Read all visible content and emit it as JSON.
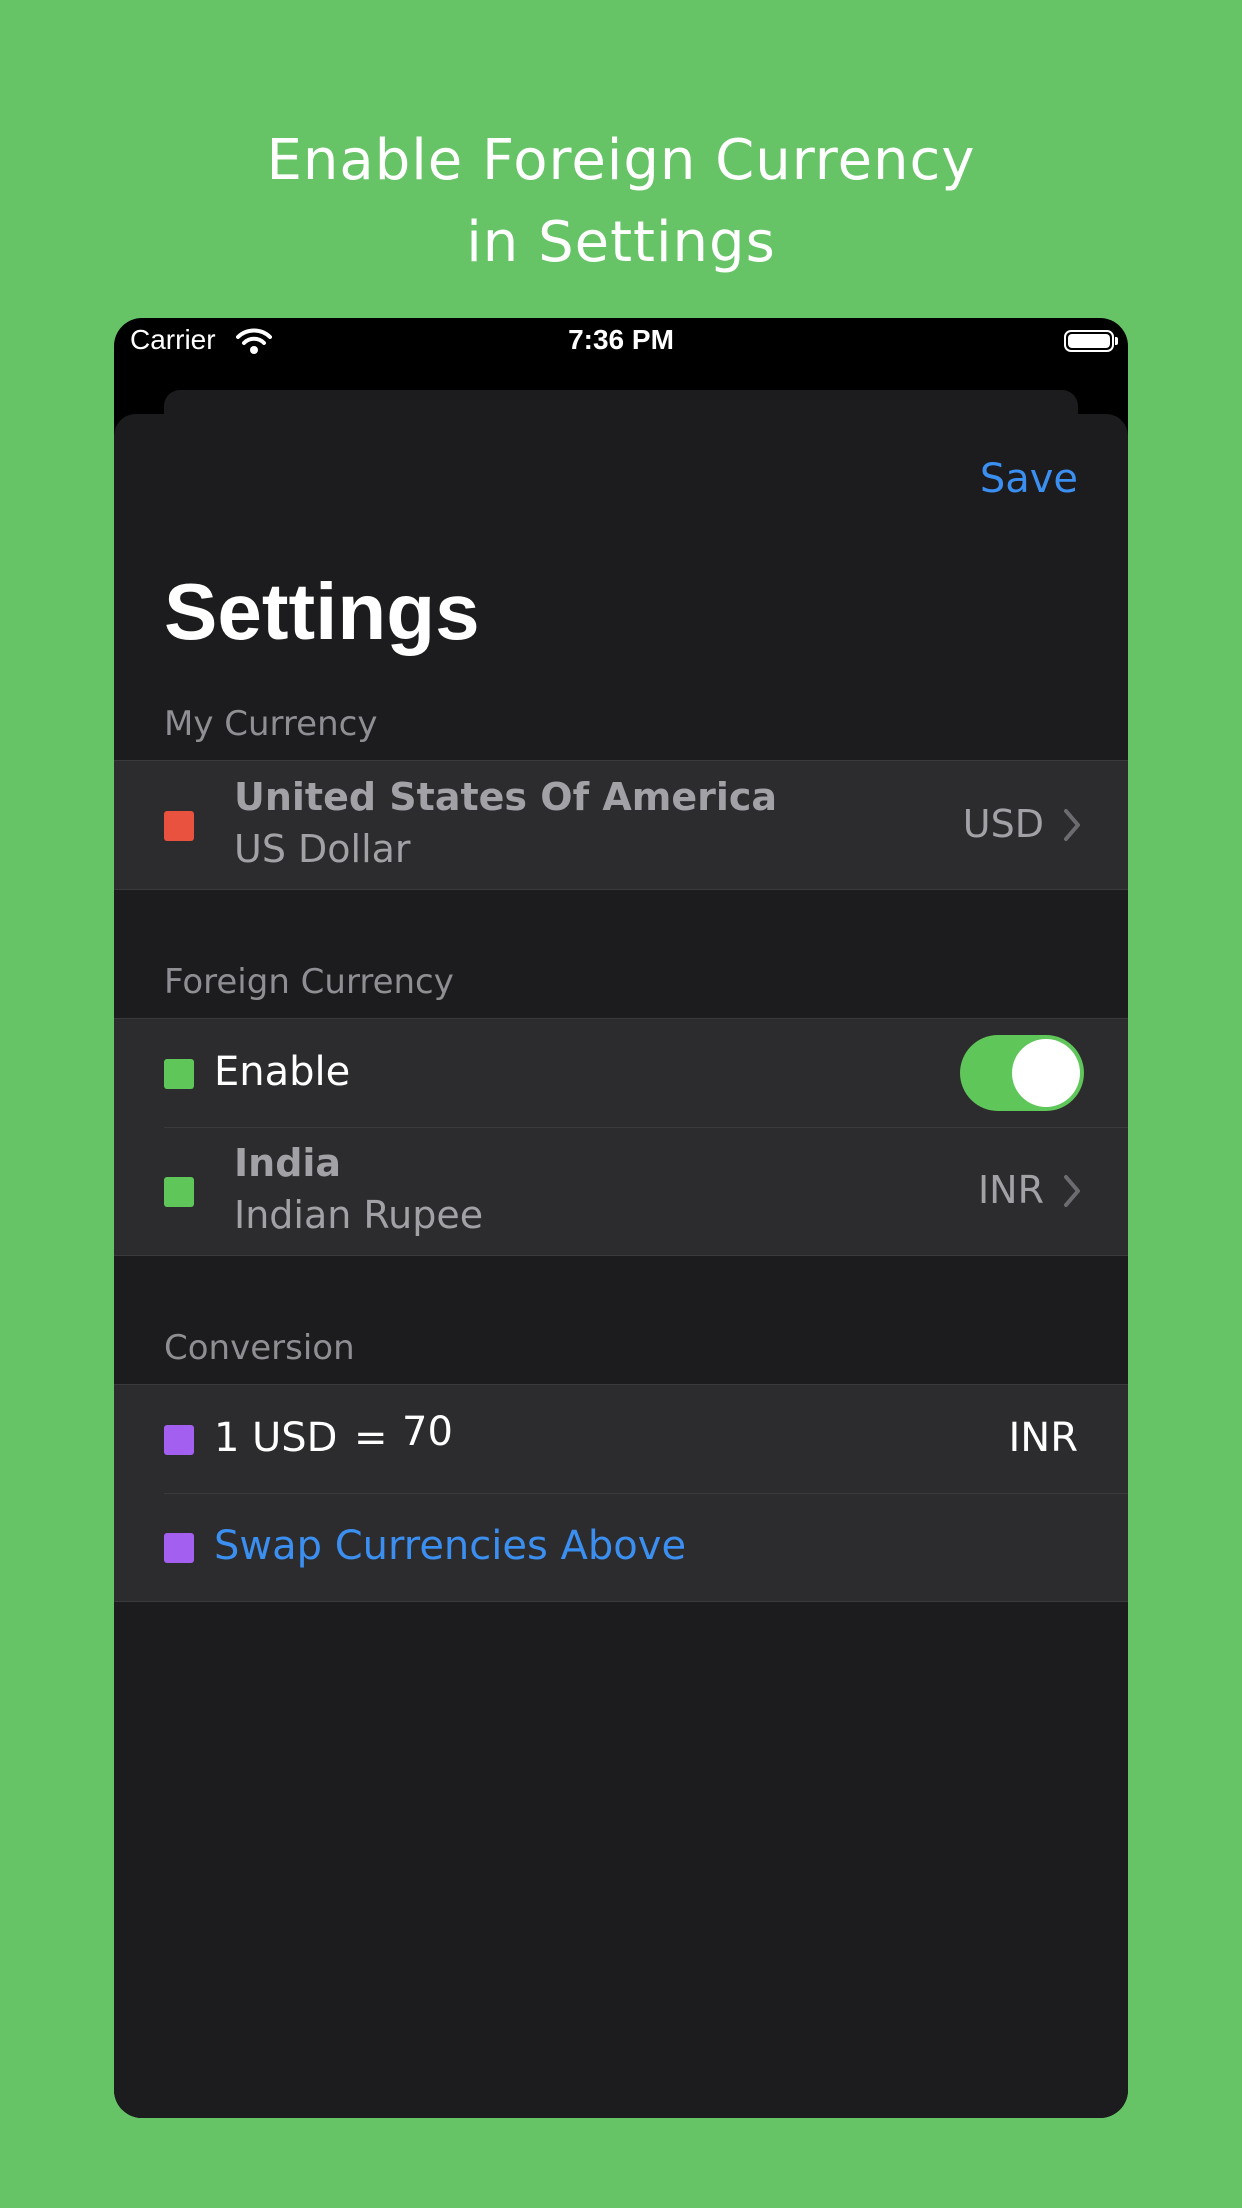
{
  "headline": {
    "line1": "Enable Foreign Currency",
    "line2": "in Settings"
  },
  "status_bar": {
    "carrier": "Carrier",
    "time": "7:36 PM"
  },
  "nav": {
    "save_label": "Save",
    "title": "Settings"
  },
  "my_currency": {
    "header": "My Currency",
    "country": "United States Of America",
    "currency_name": "US Dollar",
    "code": "USD",
    "color": "#e8523f"
  },
  "foreign_currency": {
    "header": "Foreign Currency",
    "enable_label": "Enable",
    "enabled": true,
    "country": "India",
    "currency_name": "Indian Rupee",
    "code": "INR",
    "color": "#5fc65a"
  },
  "conversion": {
    "header": "Conversion",
    "amount": "1",
    "from_code": "USD",
    "equals": "=",
    "rate": "70",
    "to_code": "INR",
    "swap_label": "Swap Currencies Above",
    "color": "#a35ff0"
  },
  "colors": {
    "background": "#66c466",
    "accent": "#3b8ff0",
    "toggle_on": "#5fc65a"
  }
}
